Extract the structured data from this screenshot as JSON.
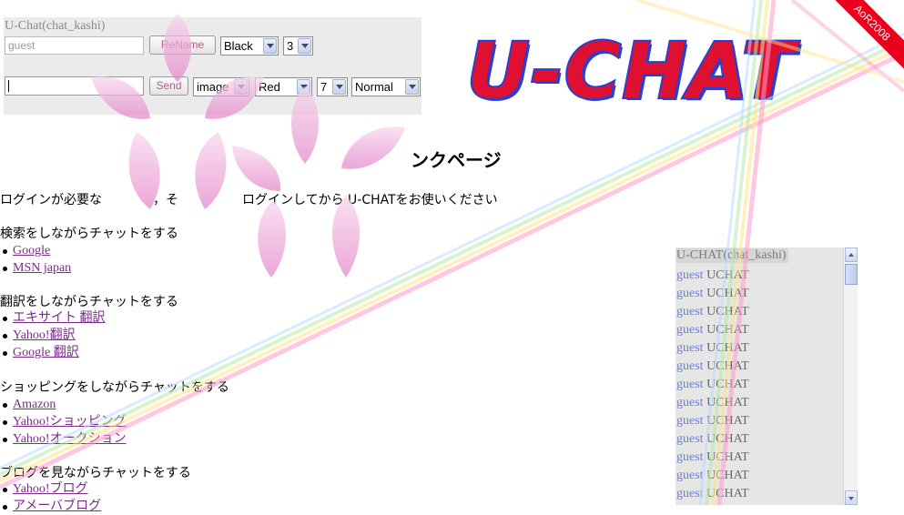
{
  "chat_panel": {
    "title": "U-Chat(chat_kashi)",
    "name_value": "guest",
    "rename_label": "ReName",
    "name_color": "Black",
    "name_size": "3",
    "message_value": "",
    "send_label": "Send",
    "image_option": "image",
    "message_color": "Red",
    "message_size": "7",
    "message_weight": "Normal"
  },
  "logo": {
    "text": "U-CHAT",
    "colors": {
      "fill": "#e01030",
      "outline": "#2a3fd0"
    }
  },
  "ribbon": {
    "text": "AoR2008",
    "color": "#e8001c"
  },
  "page": {
    "heading": "ンクページ",
    "intro": "ログインが必要な　　　　，そ　　　　　ログインしてから U-CHATをお使いください",
    "sections": [
      {
        "title": "検索をしながらチャットをする",
        "links": [
          "Google",
          "MSN japan"
        ]
      },
      {
        "title": "翻訳をしながらチャットをする",
        "links": [
          "エキサイト 翻訳",
          "Yahoo!翻訳",
          "Google 翻訳"
        ]
      },
      {
        "title": "ショッピングをしながらチャットをする",
        "links": [
          "Amazon",
          "Yahoo!ショッピング",
          "Yahoo!オークション"
        ]
      },
      {
        "title": "ブログを見ながらチャットをする",
        "links": [
          "Yahoo!ブログ",
          "アメーバブログ"
        ]
      }
    ],
    "link_color": "#7b2a8a"
  },
  "log_panel": {
    "title": "U-CHAT(chat_kashi)",
    "lines": [
      {
        "user": "guest",
        "text": "UCHAT"
      },
      {
        "user": "guest",
        "text": "UCHAT"
      },
      {
        "user": "guest",
        "text": "UCHAT"
      },
      {
        "user": "guest",
        "text": "UCHAT"
      },
      {
        "user": "guest",
        "text": "UCHAT"
      },
      {
        "user": "guest",
        "text": "UCHAT"
      },
      {
        "user": "guest",
        "text": "UCHAT"
      },
      {
        "user": "guest",
        "text": "UCHAT"
      },
      {
        "user": "guest",
        "text": "UCHAT"
      },
      {
        "user": "guest",
        "text": "UCHAT"
      },
      {
        "user": "guest",
        "text": "UCHAT"
      },
      {
        "user": "guest",
        "text": "UCHAT"
      },
      {
        "user": "guest",
        "text": "UCHAT"
      }
    ],
    "user_color": "#6b82d8"
  },
  "decor": {
    "petal_color": "#e7a6d6",
    "beam_colors": [
      "#ff8fc0",
      "#ffe27a",
      "#a9e7a0",
      "#9fd0ff"
    ]
  }
}
